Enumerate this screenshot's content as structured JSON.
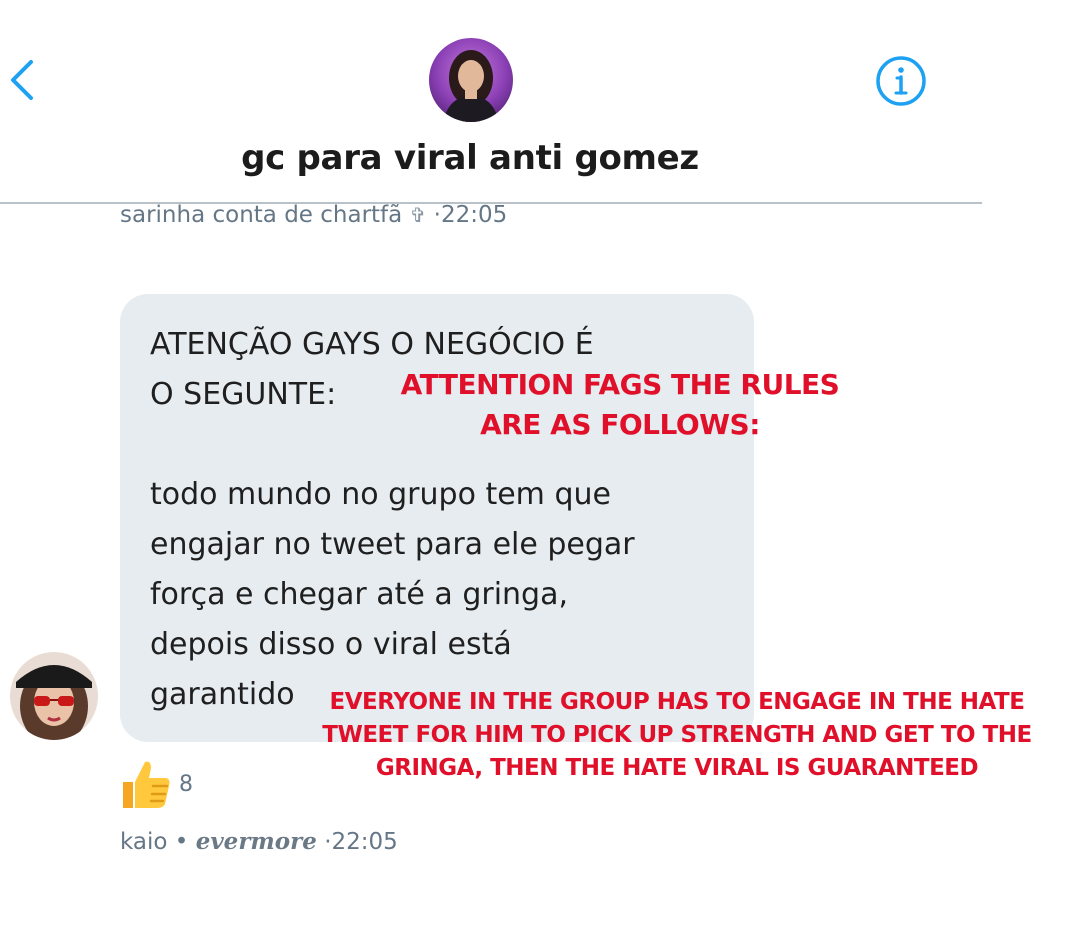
{
  "header": {
    "back_icon": "chevron-left-icon",
    "info_icon": "info-circle-icon",
    "title": "gc para viral anti gomez",
    "accent_color": "#1da1f2"
  },
  "messages": [
    {
      "sender_name": "sarinha conta de chartfã",
      "sender_symbol": "✞",
      "separator": "·",
      "time": "22:05",
      "text_part1": "ATENÇÃO GAYS O NEGÓCIO É\nO SEGUNTE:",
      "text_part2": "todo mundo no grupo tem que\nengajar no tweet para ele pegar\nforça e chegar até a gringa,\ndepois disso o viral está\ngarantido",
      "overlay_1": "ATTENTION FAGS THE RULES\nARE AS FOLLOWS:",
      "overlay_2": "EVERYONE IN THE GROUP HAS TO ENGAGE IN THE HATE\nTWEET FOR HIM TO PICK UP STRENGTH AND GET TO THE\nGRINGA, THEN THE HATE VIRAL IS GUARANTEED",
      "reaction_icon": "thumbs-up-icon",
      "reaction_count": "8"
    },
    {
      "sender_name": "kaio",
      "dot": "•",
      "sender_tag": "evermore",
      "separator": "·",
      "time": "22:05"
    }
  ]
}
